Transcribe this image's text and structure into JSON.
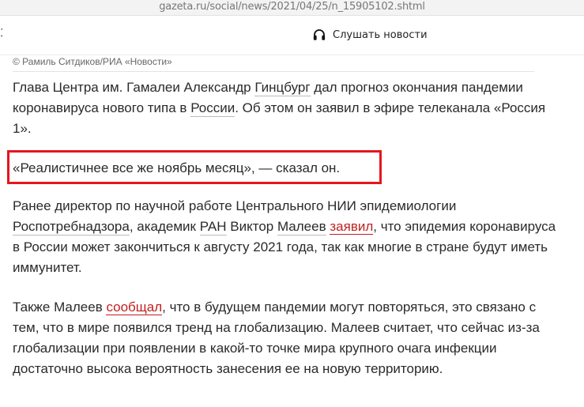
{
  "browser": {
    "url": "gazeta.ru/social/news/2021/04/25/n_15905102.shtml"
  },
  "toolbar": {
    "edge_glyph": "1",
    "listen_label": "Слушать новости",
    "listen_icon": "headphones-icon"
  },
  "photo_credit": "© Рамиль Ситдиков/РИА «Новости»",
  "article": {
    "p1": {
      "t1": "Глава Центра им. Гамалеи Александр ",
      "l1": "Гинцбург",
      "t2": " дал прогноз окончания пандемии коронавируса нового типа в ",
      "l2": "России",
      "t3": ". Об этом он заявил в эфире телеканала «Россия 1»."
    },
    "quote": "«Реалистичнее все же ноябрь месяц», — сказал он.",
    "p2": {
      "t1": "Ранее директор по научной работе Центрального НИИ эпидемиологии ",
      "l1": "Роспотребнадзора",
      "t2": ", академик ",
      "l2": "РАН",
      "t3": " Виктор ",
      "l3": "Малеев",
      "t4": " ",
      "l4": "заявил",
      "t5": ", что эпидемия коронавируса в России может закончиться к августу 2021 года, так как многие в стране будут иметь иммунитет."
    },
    "p3": {
      "t1": "Также Малеев ",
      "l1": "сообщал",
      "t2": ", что в будущем пандемии могут повторяться, это связано с тем, что в мире появился тренд на глобализацию. Малеев считает, что сейчас из-за глобализации при появлении в какой-то точке мира крупного очага инфекции достаточно высока вероятность занесения ее на новую территорию."
    }
  },
  "colors": {
    "highlight_box": "#e5161d",
    "link": "#c21f1f"
  }
}
